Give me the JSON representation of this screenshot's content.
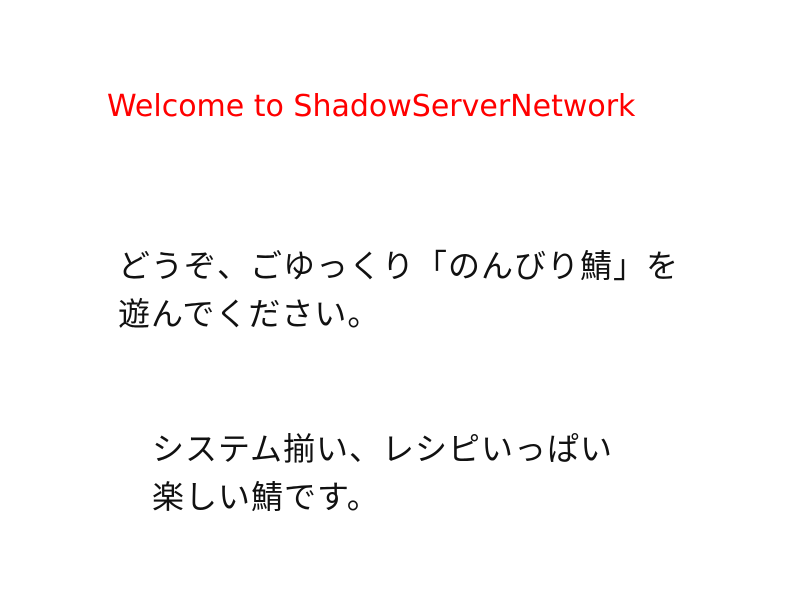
{
  "welcome": {
    "text": "Welcome to ShadowServerNetwork",
    "color": "#ff0000"
  },
  "intro": {
    "line1": "どうぞ、ごゆっくり「のんびり鯖」を",
    "line2": "遊んでください。"
  },
  "features": {
    "line1": "システム揃い、レシピいっぱい",
    "line2": "楽しい鯖です。"
  }
}
